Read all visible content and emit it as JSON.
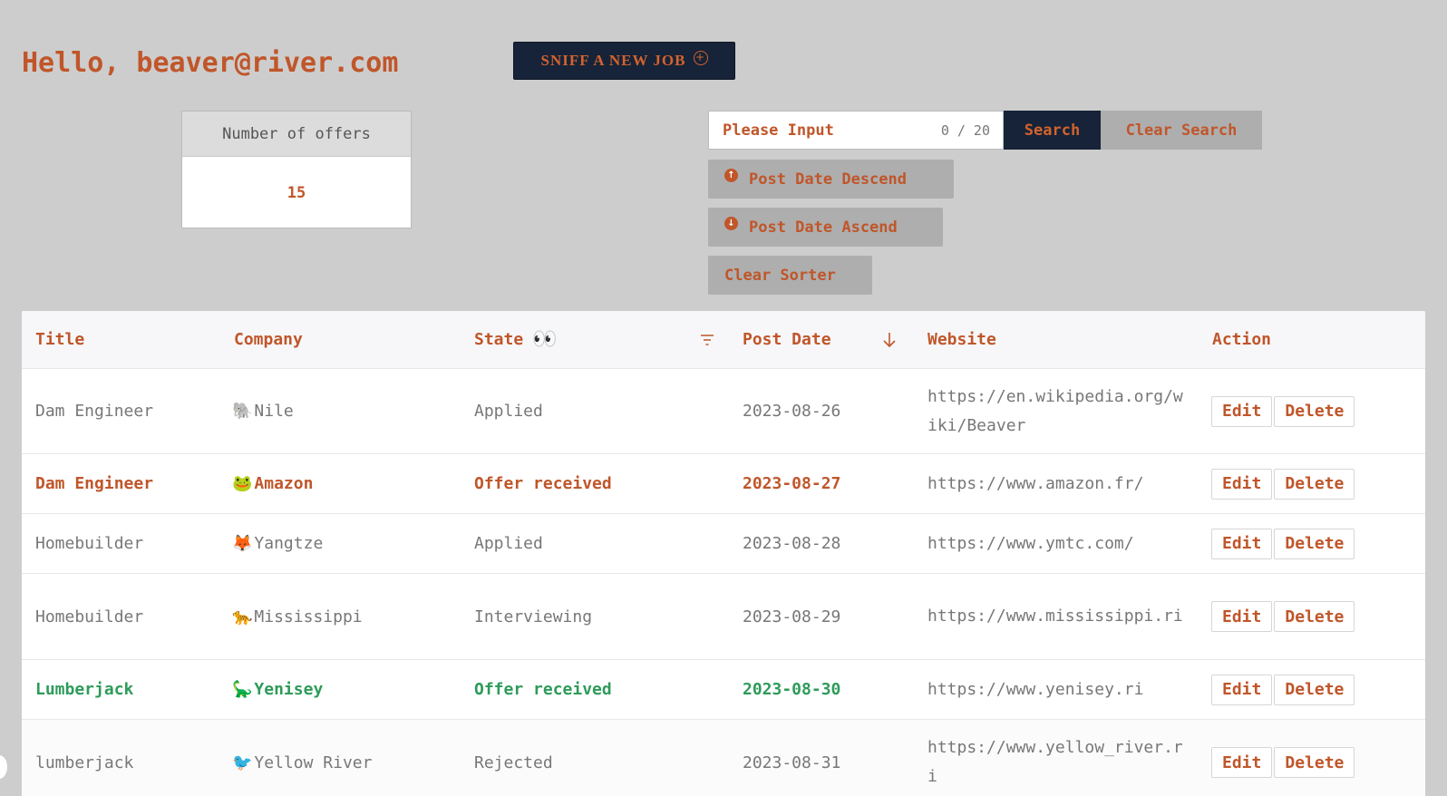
{
  "header": {
    "greeting": "Hello, beaver@river.com",
    "sniff_button": "SNIFF A NEW JOB",
    "sniff_icon": "plus-circle-icon"
  },
  "stats": {
    "label": "Number of offers",
    "value": "15"
  },
  "search": {
    "placeholder": "Please Input",
    "counter": "0 / 20",
    "search_label": "Search",
    "clear_label": "Clear Search"
  },
  "sorters": {
    "descend_label": "Post Date Descend",
    "ascend_label": "Post Date Ascend",
    "clear_label": "Clear Sorter"
  },
  "table": {
    "columns": {
      "title": "Title",
      "company": "Company",
      "state": "State",
      "state_emoji": "👀",
      "post_date": "Post Date",
      "website": "Website",
      "action": "Action"
    },
    "edit_label": "Edit",
    "delete_label": "Delete",
    "rows": [
      {
        "title": "Dam Engineer",
        "emoji": "🐘",
        "company": "Nile",
        "state": "Applied",
        "date": "2023-08-26",
        "website": "https://en.wikipedia.org/wiki/Beaver",
        "style": "normal"
      },
      {
        "title": "Dam Engineer",
        "emoji": "🐸",
        "company": "Amazon",
        "state": "Offer received",
        "date": "2023-08-27",
        "website": "https://www.amazon.fr/",
        "style": "orange"
      },
      {
        "title": "Homebuilder",
        "emoji": "🦊",
        "company": "Yangtze",
        "state": "Applied",
        "date": "2023-08-28",
        "website": "https://www.ymtc.com/",
        "style": "normal"
      },
      {
        "title": "Homebuilder",
        "emoji": "🐆",
        "company": "Mississippi",
        "state": "Interviewing",
        "date": "2023-08-29",
        "website": "https://www.mississippi.ri",
        "style": "normal"
      },
      {
        "title": "Lumberjack",
        "emoji": "🦕",
        "company": "Yenisey",
        "state": "Offer received",
        "date": "2023-08-30",
        "website": "https://www.yenisey.ri",
        "style": "green"
      },
      {
        "title": "lumberjack",
        "emoji": "🐦",
        "company": "Yellow River",
        "state": "Rejected",
        "date": "2023-08-31",
        "website": "https://www.yellow_river.ri",
        "style": "normal"
      }
    ]
  },
  "colors": {
    "accent": "#c0562a",
    "navy": "#162338",
    "green": "#2e9b5a",
    "background": "#cdcdcd"
  }
}
